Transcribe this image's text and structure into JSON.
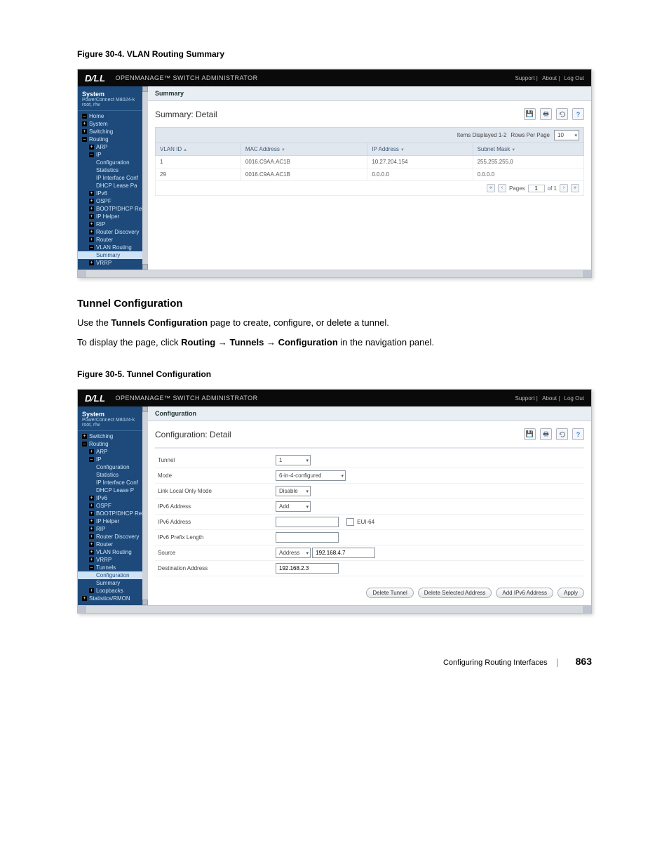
{
  "figure1": {
    "caption": "Figure 30-4.    VLAN Routing Summary",
    "header_app": "OPENMANAGE™ SWITCH ADMINISTRATOR",
    "header_links": [
      "Support",
      "About",
      "Log Out"
    ],
    "system_label": "System",
    "system_sub": "PowerConnect M8024-k\nroot, r/w",
    "tree": {
      "home": "Home",
      "system": "System",
      "switching": "Switching",
      "routing": "Routing",
      "arp": "ARP",
      "ip": "IP",
      "configuration": "Configuration",
      "statistics": "Statistics",
      "ip_interface_conf": "IP Interface Conf",
      "dhcp_lease": "DHCP Lease Pa",
      "ipv6": "IPv6",
      "ospf": "OSPF",
      "bootp": "BOOTP/DHCP Relay",
      "iphelper": "IP Helper",
      "rip": "RIP",
      "router_disc": "Router Discovery",
      "router": "Router",
      "vlan_routing": "VLAN Routing",
      "summary": "Summary",
      "vrrp": "VRRP"
    },
    "tab": "Summary",
    "detail_title": "Summary: Detail",
    "items_label": "Items Displayed 1-2",
    "rows_label": "Rows Per Page",
    "rows_value": "10",
    "cols": [
      "VLAN ID",
      "MAC Address",
      "IP Address",
      "Subnet Mask"
    ],
    "rows": [
      {
        "vlan": "1",
        "mac": "0016.C9AA.AC1B",
        "ip": "10.27.204.154",
        "mask": "255.255.255.0"
      },
      {
        "vlan": "29",
        "mac": "0016.C9AA.AC1B",
        "ip": "0.0.0.0",
        "mask": "0.0.0.0"
      }
    ],
    "pager": {
      "pages_label": "Pages",
      "page": "1",
      "of_label": "of 1"
    }
  },
  "section": {
    "heading": "Tunnel Configuration",
    "p1_pre": "Use the ",
    "p1_bold": "Tunnels Configuration",
    "p1_post": " page to create, configure, or delete a tunnel.",
    "p2_pre": "To display the page, click ",
    "p2_b1": "Routing",
    "p2_arrow": " → ",
    "p2_b2": "Tunnels",
    "p2_b3": "Configuration",
    "p2_post": " in the navigation panel."
  },
  "figure2": {
    "caption": "Figure 30-5.    Tunnel Configuration",
    "header_app": "OPENMANAGE™ SWITCH ADMINISTRATOR",
    "header_links": [
      "Support",
      "About",
      "Log Out"
    ],
    "system_label": "System",
    "system_sub": "PowerConnect M8024-k\nroot, r/w",
    "tree": {
      "switching": "Switching",
      "routing": "Routing",
      "arp": "ARP",
      "ip": "IP",
      "configuration": "Configuration",
      "statistics": "Statistics",
      "ip_interface_conf": "IP Interface Conf",
      "dhcp_lease": "DHCP Lease P",
      "ipv6": "IPv6",
      "ospf": "OSPF",
      "bootp": "BOOTP/DHCP Relay",
      "iphelper": "IP Helper",
      "rip": "RIP",
      "router_disc": "Router Discovery",
      "router": "Router",
      "vlan_routing": "VLAN Routing",
      "vrrp": "VRRP",
      "tunnels": "Tunnels",
      "t_configuration": "Configuration",
      "t_summary": "Summary",
      "loopbacks": "Loopbacks",
      "stats_rmon": "Statistics/RMON"
    },
    "tab": "Configuration",
    "detail_title": "Configuration: Detail",
    "fields": {
      "tunnel": {
        "label": "Tunnel",
        "value": "1"
      },
      "mode": {
        "label": "Mode",
        "value": "6-in-4-configured"
      },
      "lllmode": {
        "label": "Link Local Only Mode",
        "value": "Disable"
      },
      "ipv6addr": {
        "label": "IPv6 Address",
        "value": "Add"
      },
      "ipv6addr2": {
        "label": "IPv6 Address",
        "chk_label": "EUI-64"
      },
      "prefix": {
        "label": "IPv6 Prefix Length"
      },
      "source": {
        "label": "Source",
        "sel": "Address",
        "value": "192.168.4.7"
      },
      "dest": {
        "label": "Destination Address",
        "value": "192.168.2.3"
      }
    },
    "buttons": {
      "delete": "Delete Tunnel",
      "delsel": "Delete Selected Address",
      "addipv6": "Add IPv6 Address",
      "apply": "Apply"
    }
  },
  "footer": {
    "section": "Configuring Routing Interfaces",
    "page": "863"
  }
}
